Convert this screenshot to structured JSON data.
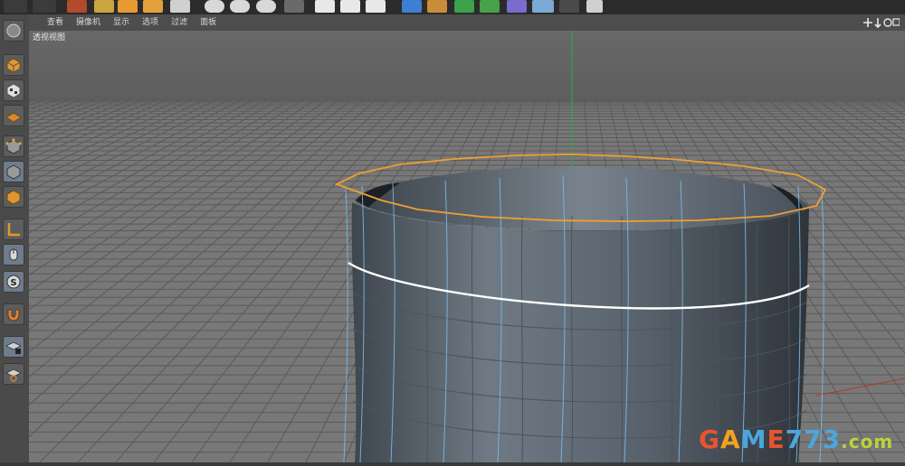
{
  "viewport_menu": {
    "items": [
      "查看",
      "摄像机",
      "显示",
      "选项",
      "过滤",
      "面板"
    ]
  },
  "viewport": {
    "label": "透视视图"
  },
  "watermark": {
    "part1": "G",
    "part2": "A",
    "part3": "M",
    "part4": "E",
    "part5": "773",
    "part6": ".com"
  },
  "colors": {
    "grid_floor": "#7a7a7a",
    "grid_line": "#555555",
    "sky": "#6b6b6b",
    "object_body": "#5c6670",
    "selection_orange": "#f0a030",
    "edge_white": "#ffffff",
    "wire_blue": "#7ab8e8",
    "y_axis_green": "#2ea84a"
  },
  "icons": {
    "palette": [
      "model-mode-icon",
      "object-mode-icon",
      "texture-mode-icon",
      "workplane-icon",
      "points-mode-icon",
      "polygon-mode-icon",
      "axis-mode-icon",
      "tweak-mode-icon",
      "solo-icon",
      "snap-icon",
      "lock-workplane-icon",
      "workplane-grid-icon"
    ]
  }
}
